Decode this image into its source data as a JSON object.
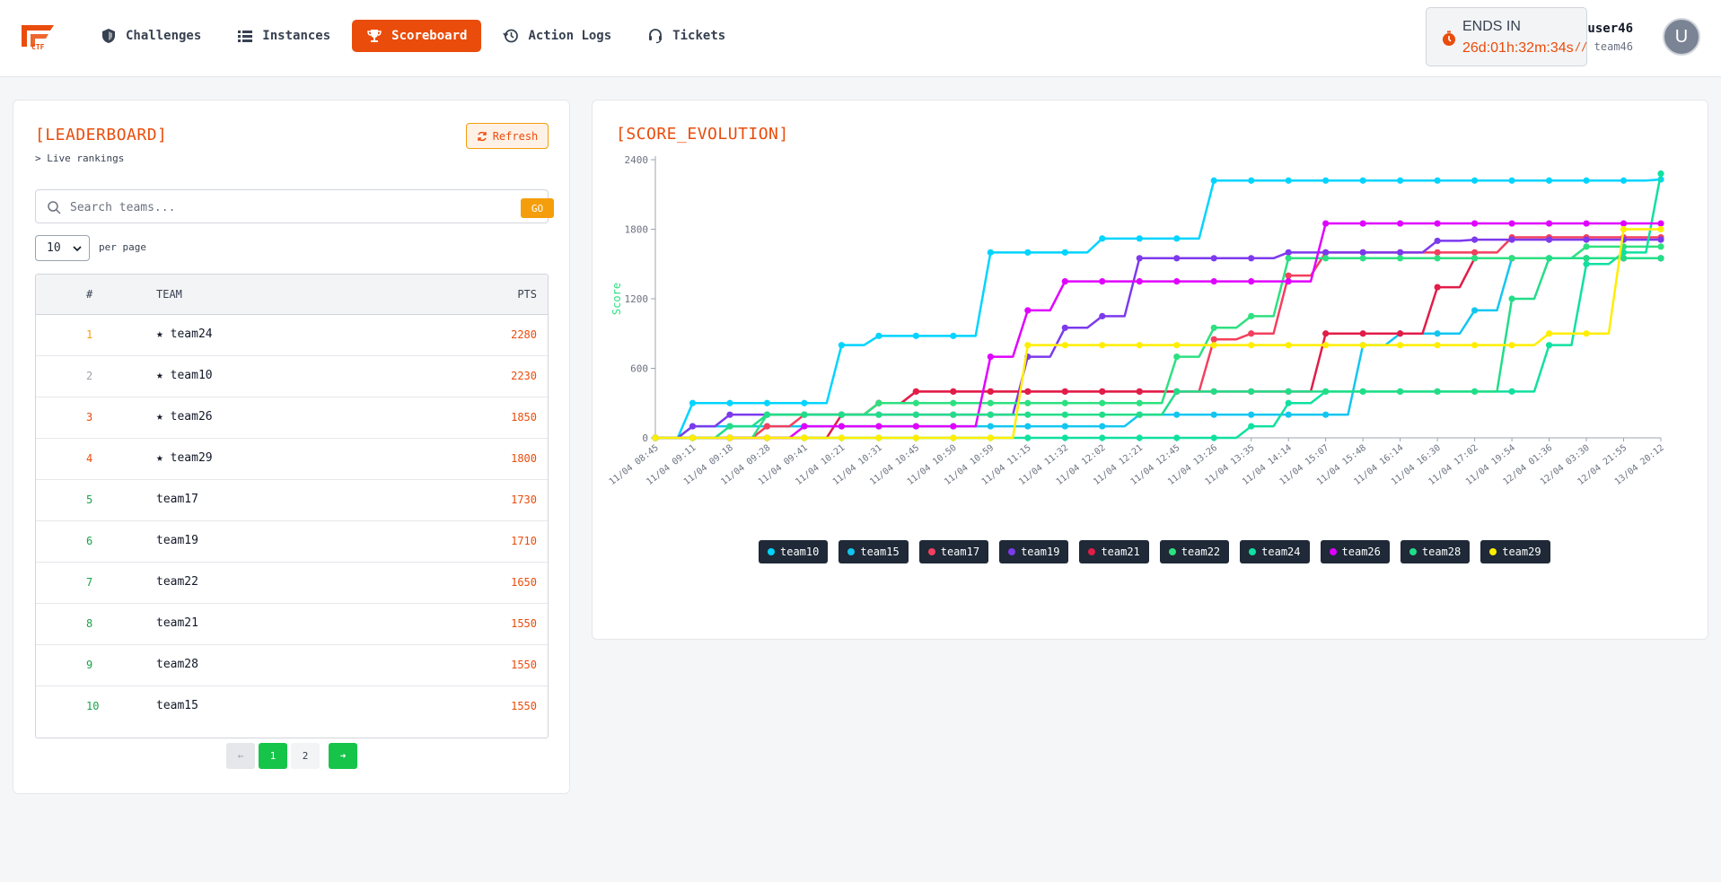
{
  "nav": {
    "items": [
      {
        "label": "Challenges",
        "icon": "shield-icon"
      },
      {
        "label": "Instances",
        "icon": "list-icon"
      },
      {
        "label": "Scoreboard",
        "icon": "trophy-icon",
        "active": true
      },
      {
        "label": "Action Logs",
        "icon": "history-icon"
      },
      {
        "label": "Tickets",
        "icon": "headset-icon"
      }
    ],
    "accent": "#ea4c0b"
  },
  "timer": {
    "label": "ENDS IN",
    "value": "26d:01h:32m:34s"
  },
  "user": {
    "name": "user46",
    "team_prefix": "//",
    "team": "team46",
    "avatar_letter": "U"
  },
  "leaderboard": {
    "title": "[LEADERBOARD]",
    "subtitle": "> Live rankings",
    "refresh_label": "Refresh",
    "search_placeholder": "Search teams...",
    "search_value": "",
    "go_label": "GO",
    "per_page_value": "10",
    "per_page_label": "per page",
    "headers": {
      "rank": "#",
      "team": "TEAM",
      "pts": "PTS"
    },
    "rows": [
      {
        "rank": "1",
        "team": "★ team24",
        "pts": "2280",
        "rank_color": "#f59e0b"
      },
      {
        "rank": "2",
        "team": "★ team10",
        "pts": "2230",
        "rank_color": "#9ca3af"
      },
      {
        "rank": "3",
        "team": "★ team26",
        "pts": "1850",
        "rank_color": "#ea4c0b"
      },
      {
        "rank": "4",
        "team": "★ team29",
        "pts": "1800",
        "rank_color": "#ea4c0b"
      },
      {
        "rank": "5",
        "team": "team17",
        "pts": "1730",
        "rank_color": "#16a34a"
      },
      {
        "rank": "6",
        "team": "team19",
        "pts": "1710",
        "rank_color": "#16a34a"
      },
      {
        "rank": "7",
        "team": "team22",
        "pts": "1650",
        "rank_color": "#16a34a"
      },
      {
        "rank": "8",
        "team": "team21",
        "pts": "1550",
        "rank_color": "#16a34a"
      },
      {
        "rank": "9",
        "team": "team28",
        "pts": "1550",
        "rank_color": "#16a34a"
      },
      {
        "rank": "10",
        "team": "team15",
        "pts": "1550",
        "rank_color": "#16a34a"
      }
    ],
    "pagination": {
      "prev": "←",
      "pages": [
        "1",
        "2"
      ],
      "current": "1",
      "next": "➜"
    }
  },
  "chart_data": {
    "type": "line",
    "title": "[SCORE_EVOLUTION]",
    "ylabel": "Score",
    "xlabel": "",
    "ylim": [
      0,
      2400
    ],
    "yticks": [
      0,
      600,
      1200,
      1800,
      2400
    ],
    "grid": false,
    "legend_position": "bottom-center",
    "x": [
      "11/04 08:45",
      "11/04 09:11",
      "11/04 09:18",
      "11/04 09:28",
      "11/04 09:41",
      "11/04 10:21",
      "11/04 10:31",
      "11/04 10:45",
      "11/04 10:50",
      "11/04 10:59",
      "11/04 11:15",
      "11/04 11:32",
      "11/04 12:02",
      "11/04 12:21",
      "11/04 12:45",
      "11/04 13:26",
      "11/04 13:35",
      "11/04 14:14",
      "11/04 15:07",
      "11/04 15:48",
      "11/04 16:14",
      "11/04 16:30",
      "11/04 17:02",
      "11/04 19:54",
      "12/04 01:36",
      "12/04 03:30",
      "12/04 21:55",
      "13/04 20:12"
    ],
    "series": [
      {
        "name": "team10",
        "color": "#00d4ff",
        "values": [
          0,
          300,
          300,
          300,
          300,
          800,
          880,
          880,
          880,
          1600,
          1600,
          1600,
          1720,
          1720,
          1720,
          2220,
          2220,
          2220,
          2220,
          2220,
          2220,
          2220,
          2220,
          2220,
          2220,
          2220,
          2220,
          2230
        ]
      },
      {
        "name": "team15",
        "color": "#12c6f0",
        "values": [
          0,
          100,
          100,
          100,
          100,
          100,
          100,
          100,
          100,
          100,
          100,
          100,
          100,
          200,
          200,
          200,
          200,
          200,
          200,
          800,
          900,
          900,
          1100,
          1550,
          1550,
          1550,
          1550,
          1550
        ]
      },
      {
        "name": "team17",
        "color": "#f43f5e",
        "values": [
          0,
          0,
          0,
          100,
          200,
          200,
          300,
          400,
          400,
          400,
          400,
          400,
          400,
          400,
          400,
          850,
          900,
          1400,
          1600,
          1600,
          1600,
          1600,
          1600,
          1730,
          1730,
          1730,
          1730,
          1730
        ]
      },
      {
        "name": "team19",
        "color": "#7c3aed",
        "values": [
          0,
          100,
          200,
          200,
          200,
          200,
          200,
          200,
          200,
          200,
          700,
          950,
          1050,
          1550,
          1550,
          1550,
          1550,
          1600,
          1600,
          1600,
          1600,
          1700,
          1710,
          1710,
          1710,
          1710,
          1710,
          1710
        ]
      },
      {
        "name": "team21",
        "color": "#e11d48",
        "values": [
          0,
          0,
          0,
          0,
          0,
          200,
          300,
          400,
          400,
          400,
          400,
          400,
          400,
          400,
          400,
          400,
          400,
          400,
          900,
          900,
          900,
          1300,
          1550,
          1550,
          1550,
          1550,
          1550,
          1550
        ]
      },
      {
        "name": "team22",
        "color": "#2de080",
        "values": [
          0,
          0,
          0,
          200,
          200,
          200,
          300,
          300,
          300,
          300,
          300,
          300,
          300,
          300,
          700,
          950,
          1050,
          1550,
          1550,
          1550,
          1550,
          1550,
          1550,
          1550,
          1550,
          1650,
          1650,
          1650
        ]
      },
      {
        "name": "team24",
        "color": "#10e0a0",
        "values": [
          0,
          0,
          0,
          0,
          0,
          0,
          0,
          0,
          0,
          0,
          0,
          0,
          0,
          0,
          0,
          0,
          100,
          300,
          400,
          400,
          400,
          400,
          400,
          400,
          800,
          1500,
          1600,
          2280
        ]
      },
      {
        "name": "team26",
        "color": "#e000ff",
        "values": [
          0,
          0,
          0,
          0,
          100,
          100,
          100,
          100,
          100,
          700,
          1100,
          1350,
          1350,
          1350,
          1350,
          1350,
          1350,
          1350,
          1850,
          1850,
          1850,
          1850,
          1850,
          1850,
          1850,
          1850,
          1850,
          1850
        ]
      },
      {
        "name": "team28",
        "color": "#22dd88",
        "values": [
          0,
          0,
          100,
          200,
          200,
          200,
          200,
          200,
          200,
          200,
          200,
          200,
          200,
          200,
          400,
          400,
          400,
          400,
          400,
          400,
          400,
          400,
          400,
          1200,
          1550,
          1550,
          1550,
          1550
        ]
      },
      {
        "name": "team29",
        "color": "#ffee00",
        "values": [
          0,
          0,
          0,
          0,
          0,
          0,
          0,
          0,
          0,
          0,
          800,
          800,
          800,
          800,
          800,
          800,
          800,
          800,
          800,
          800,
          800,
          800,
          800,
          800,
          900,
          900,
          1800,
          1800
        ]
      }
    ]
  }
}
